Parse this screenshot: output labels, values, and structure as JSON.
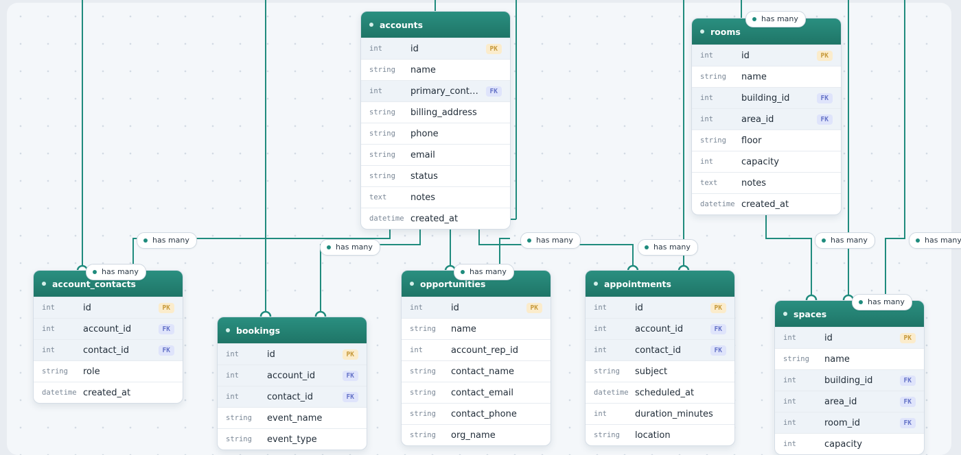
{
  "relations": [
    {
      "label": "has many"
    },
    {
      "label": "has many"
    },
    {
      "label": "has many"
    },
    {
      "label": "has many"
    },
    {
      "label": "has many"
    },
    {
      "label": "has many"
    },
    {
      "label": "has many"
    },
    {
      "label": "has many"
    },
    {
      "label": "has many"
    },
    {
      "label": "has many"
    }
  ],
  "tables": {
    "accounts": {
      "name": "accounts",
      "columns": [
        {
          "type": "int",
          "name": "id",
          "key": "PK"
        },
        {
          "type": "string",
          "name": "name"
        },
        {
          "type": "int",
          "name": "primary_contact_id",
          "key": "FK"
        },
        {
          "type": "string",
          "name": "billing_address"
        },
        {
          "type": "string",
          "name": "phone"
        },
        {
          "type": "string",
          "name": "email"
        },
        {
          "type": "string",
          "name": "status"
        },
        {
          "type": "text",
          "name": "notes"
        },
        {
          "type": "datetime",
          "name": "created_at"
        }
      ]
    },
    "rooms": {
      "name": "rooms",
      "columns": [
        {
          "type": "int",
          "name": "id",
          "key": "PK"
        },
        {
          "type": "string",
          "name": "name"
        },
        {
          "type": "int",
          "name": "building_id",
          "key": "FK"
        },
        {
          "type": "int",
          "name": "area_id",
          "key": "FK"
        },
        {
          "type": "string",
          "name": "floor"
        },
        {
          "type": "int",
          "name": "capacity"
        },
        {
          "type": "text",
          "name": "notes"
        },
        {
          "type": "datetime",
          "name": "created_at"
        }
      ]
    },
    "account_contacts": {
      "name": "account_contacts",
      "columns": [
        {
          "type": "int",
          "name": "id",
          "key": "PK"
        },
        {
          "type": "int",
          "name": "account_id",
          "key": "FK"
        },
        {
          "type": "int",
          "name": "contact_id",
          "key": "FK"
        },
        {
          "type": "string",
          "name": "role"
        },
        {
          "type": "datetime",
          "name": "created_at"
        }
      ]
    },
    "bookings": {
      "name": "bookings",
      "columns": [
        {
          "type": "int",
          "name": "id",
          "key": "PK"
        },
        {
          "type": "int",
          "name": "account_id",
          "key": "FK"
        },
        {
          "type": "int",
          "name": "contact_id",
          "key": "FK"
        },
        {
          "type": "string",
          "name": "event_name"
        },
        {
          "type": "string",
          "name": "event_type"
        }
      ]
    },
    "opportunities": {
      "name": "opportunities",
      "columns": [
        {
          "type": "int",
          "name": "id",
          "key": "PK"
        },
        {
          "type": "string",
          "name": "name"
        },
        {
          "type": "int",
          "name": "account_rep_id"
        },
        {
          "type": "string",
          "name": "contact_name"
        },
        {
          "type": "string",
          "name": "contact_email"
        },
        {
          "type": "string",
          "name": "contact_phone"
        },
        {
          "type": "string",
          "name": "org_name"
        }
      ]
    },
    "appointments": {
      "name": "appointments",
      "columns": [
        {
          "type": "int",
          "name": "id",
          "key": "PK"
        },
        {
          "type": "int",
          "name": "account_id",
          "key": "FK"
        },
        {
          "type": "int",
          "name": "contact_id",
          "key": "FK"
        },
        {
          "type": "string",
          "name": "subject"
        },
        {
          "type": "datetime",
          "name": "scheduled_at"
        },
        {
          "type": "int",
          "name": "duration_minutes"
        },
        {
          "type": "string",
          "name": "location"
        }
      ]
    },
    "spaces": {
      "name": "spaces",
      "columns": [
        {
          "type": "int",
          "name": "id",
          "key": "PK"
        },
        {
          "type": "string",
          "name": "name"
        },
        {
          "type": "int",
          "name": "building_id",
          "key": "FK"
        },
        {
          "type": "int",
          "name": "area_id",
          "key": "FK"
        },
        {
          "type": "int",
          "name": "room_id",
          "key": "FK"
        },
        {
          "type": "int",
          "name": "capacity"
        }
      ]
    }
  }
}
